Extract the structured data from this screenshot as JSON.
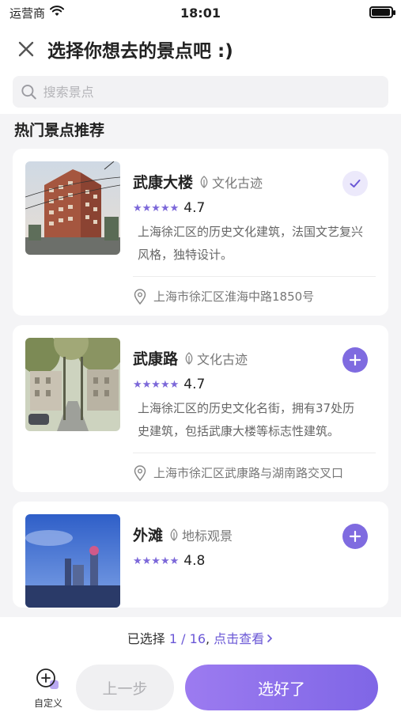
{
  "status_bar": {
    "carrier": "运营商",
    "time": "18:01",
    "battery_level": 0.95
  },
  "header": {
    "title": "选择你想去的景点吧 :)"
  },
  "search": {
    "placeholder": "搜索景点",
    "value": ""
  },
  "section": {
    "title": "热门景点推荐"
  },
  "attractions": [
    {
      "name": "武康大楼",
      "tag": "文化古迹",
      "rating": "4.7",
      "stars": "★★★★★",
      "description": "上海徐汇区的历史文化建筑，法国文艺复兴风格，独特设计。",
      "address": "上海市徐汇区淮海中路1850号",
      "selected": true
    },
    {
      "name": "武康路",
      "tag": "文化古迹",
      "rating": "4.7",
      "stars": "★★★★★",
      "description": "上海徐汇区的历史文化名街，拥有37处历史建筑，包括武康大楼等标志性建筑。",
      "address": "上海市徐汇区武康路与湖南路交叉口",
      "selected": false
    },
    {
      "name": "外滩",
      "tag": "地标观景",
      "rating": "4.8",
      "stars": "★★★★★",
      "selected": false
    }
  ],
  "footer": {
    "selected_prefix": "已选择 ",
    "selected_count": "1 / 16",
    "separator": ", ",
    "view_link": "点击查看",
    "custom_label": "自定义",
    "prev_label": "上一步",
    "done_label": "选好了"
  },
  "colors": {
    "accent": "#7f6be0",
    "accent_light": "#ece9fb",
    "star": "#7c68d9"
  }
}
